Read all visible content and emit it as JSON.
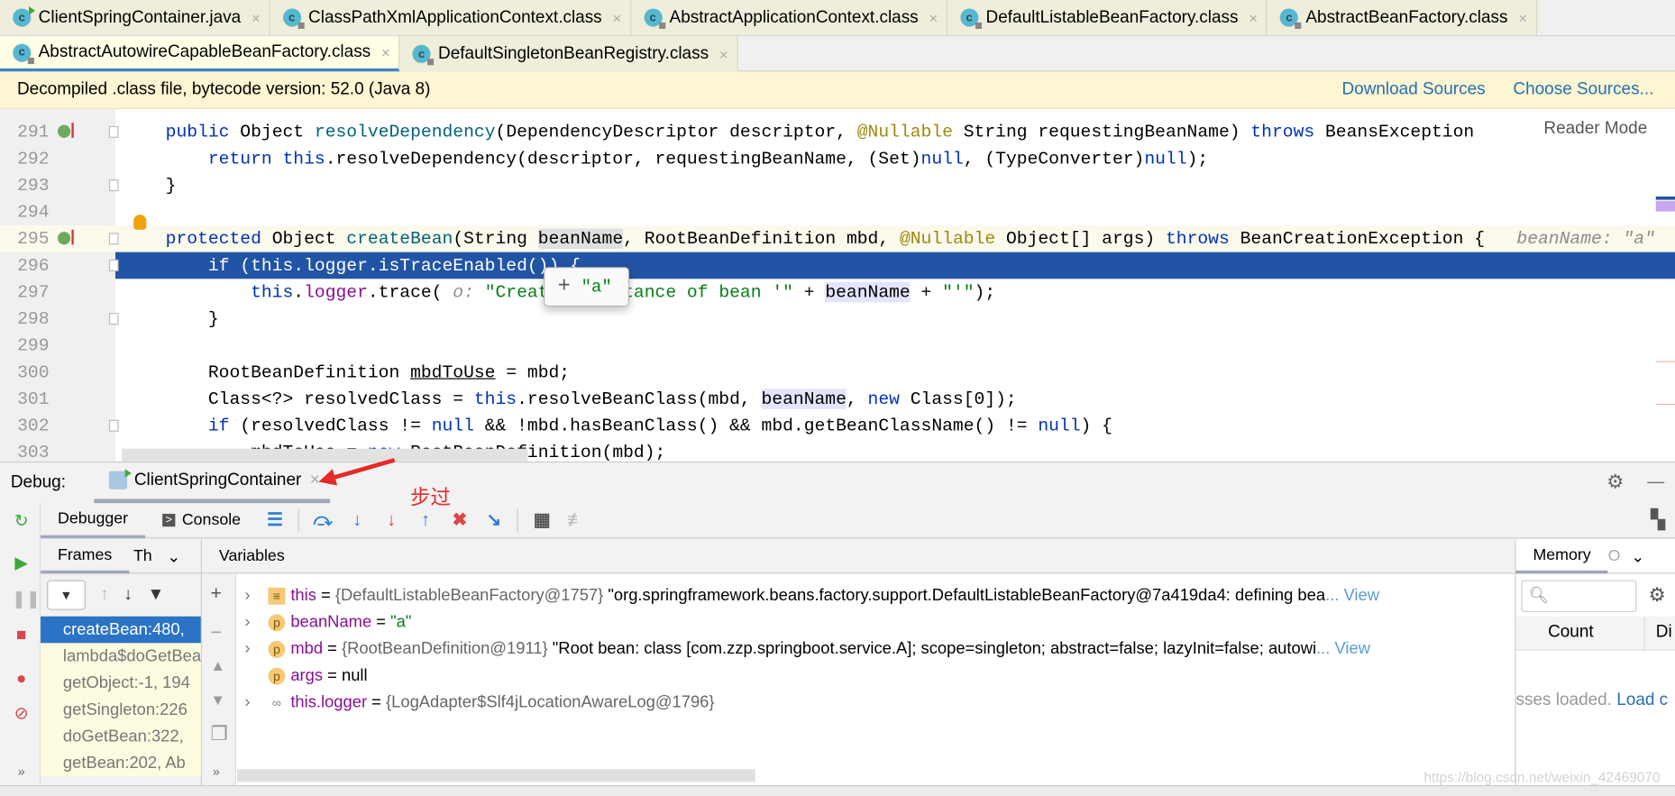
{
  "tabs_row1": [
    {
      "label": "ClientSpringContainer.java",
      "icon": "java-class-run-icon"
    },
    {
      "label": "ClassPathXmlApplicationContext.class",
      "icon": "class-file-icon"
    },
    {
      "label": "AbstractApplicationContext.class",
      "icon": "class-file-icon"
    },
    {
      "label": "DefaultListableBeanFactory.class",
      "icon": "class-file-icon"
    },
    {
      "label": "AbstractBeanFactory.class",
      "icon": "class-file-icon"
    }
  ],
  "tabs_row2": [
    {
      "label": "AbstractAutowireCapableBeanFactory.class",
      "icon": "class-file-icon",
      "active": true
    },
    {
      "label": "DefaultSingletonBeanRegistry.class",
      "icon": "class-file-icon"
    }
  ],
  "tab_close": "×",
  "class_icon_letter": "c",
  "notice": {
    "text": "Decompiled .class file, bytecode version: 52.0 (Java 8)",
    "download": "Download Sources",
    "choose": "Choose Sources..."
  },
  "editor": {
    "reader_mode": "Reader Mode",
    "tooltip": {
      "plus": "+",
      "value": "\"a\""
    },
    "lines": [
      {
        "n": "291",
        "impl": true,
        "tokens": [
          [
            "public ",
            "kw"
          ],
          [
            "Object ",
            ""
          ],
          [
            "resolveDependency",
            "fn"
          ],
          [
            "(DependencyDescriptor descriptor, ",
            ""
          ],
          [
            "@Nullable ",
            "ann"
          ],
          [
            "String requestingBeanName) ",
            ""
          ],
          [
            "throws ",
            "kw"
          ],
          [
            "BeansException ",
            ""
          ]
        ]
      },
      {
        "n": "292",
        "tokens": [
          [
            "    return ",
            "kw"
          ],
          [
            "this",
            "kw"
          ],
          [
            ".resolveDependency(descriptor, requestingBeanName, (Set)",
            ""
          ],
          [
            "null",
            "kw"
          ],
          [
            ", (TypeConverter)",
            ""
          ],
          [
            "null",
            "kw"
          ],
          [
            ");",
            ""
          ]
        ]
      },
      {
        "n": "293",
        "tokens": [
          [
            "}",
            ""
          ]
        ]
      },
      {
        "n": "294",
        "tokens": []
      },
      {
        "n": "295",
        "impl": true,
        "caret": true,
        "tokens": [
          [
            "protected ",
            "kw"
          ],
          [
            "Object ",
            ""
          ],
          [
            "createBean",
            "fn"
          ],
          [
            "(String ",
            ""
          ],
          [
            "beanName",
            "hov"
          ],
          [
            ", RootBeanDefinition mbd, ",
            ""
          ],
          [
            "@Nullable ",
            "ann"
          ],
          [
            "Object[] args) ",
            ""
          ],
          [
            "throws ",
            "kw"
          ],
          [
            "BeanCreationException {   ",
            ""
          ],
          [
            "beanName: \"a\"",
            "inl"
          ]
        ]
      },
      {
        "n": "296",
        "exec": true,
        "tokens": [
          [
            "    if (this.logger.isTraceEnabled()) {",
            ""
          ]
        ]
      },
      {
        "n": "297",
        "tokens": [
          [
            "        this",
            "kw"
          ],
          [
            ".",
            ""
          ],
          [
            "logger",
            "fld"
          ],
          [
            ".trace( ",
            ""
          ],
          [
            "o: ",
            "inl"
          ],
          [
            "\"Creating instance of bean '\"",
            "str"
          ],
          [
            " + ",
            ""
          ],
          [
            "beanName",
            "sel"
          ],
          [
            " + ",
            ""
          ],
          [
            "\"'\"",
            "str"
          ],
          [
            ");",
            ""
          ]
        ]
      },
      {
        "n": "298",
        "tokens": [
          [
            "    }",
            ""
          ]
        ]
      },
      {
        "n": "299",
        "tokens": []
      },
      {
        "n": "300",
        "tokens": [
          [
            "    RootBeanDefinition ",
            ""
          ],
          [
            "mbdToUse",
            "u"
          ],
          [
            " = mbd;",
            ""
          ]
        ]
      },
      {
        "n": "301",
        "tokens": [
          [
            "    Class<?> resolvedClass = ",
            ""
          ],
          [
            "this",
            "kw"
          ],
          [
            ".resolveBeanClass(mbd, ",
            ""
          ],
          [
            "beanName",
            "sel"
          ],
          [
            ", ",
            ""
          ],
          [
            "new ",
            "kw"
          ],
          [
            "Class[0]);",
            ""
          ]
        ]
      },
      {
        "n": "302",
        "tokens": [
          [
            "    if ",
            "kw"
          ],
          [
            "(resolvedClass != ",
            ""
          ],
          [
            "null ",
            "kw"
          ],
          [
            "&& !mbd.hasBeanClass() && mbd.getBeanClassName() != ",
            ""
          ],
          [
            "null",
            "kw"
          ],
          [
            ") {",
            ""
          ]
        ]
      },
      {
        "n": "303",
        "tokens": [
          [
            "        ",
            ""
          ],
          [
            "mbdToUse",
            "u"
          ],
          [
            " = ",
            ""
          ],
          [
            "new ",
            "kw"
          ],
          [
            "RootBeanDefinition(mbd);",
            ""
          ]
        ]
      }
    ]
  },
  "debug": {
    "label": "Debug:",
    "session": "ClientSpringContainer",
    "annotation": "步过",
    "tabs": {
      "debugger": "Debugger",
      "console": "Console"
    },
    "frames_tab": "Frames",
    "threads_tab": "Th",
    "frames": [
      "createBean:480, ",
      "lambda$doGetBean",
      "getObject:-1, 194",
      "getSingleton:226",
      "doGetBean:322, ",
      "getBean:202, Ab"
    ],
    "variables_title": "Variables",
    "variables": [
      {
        "name": "this",
        "type": "{DefaultListableBeanFactory@1757}",
        "value": " \"org.springframework.beans.factory.support.DefaultListableBeanFactory@7a419da4: defining bea",
        "view": "... View",
        "icon": "field-list-icon",
        "expandable": true
      },
      {
        "name": "beanName",
        "eq": " = ",
        "str": "\"a\"",
        "icon": "parameter-icon",
        "expandable": true
      },
      {
        "name": "mbd",
        "type": "{RootBeanDefinition@1911}",
        "value": " \"Root bean: class [com.zzp.springboot.service.A]; scope=singleton; abstract=false; lazyInit=false; autowi",
        "view": "... View",
        "icon": "parameter-icon",
        "expandable": true
      },
      {
        "name": "args",
        "eq": " = ",
        "plain": "null",
        "icon": "parameter-icon",
        "expandable": false
      },
      {
        "name": "this.logger",
        "type": "{LogAdapter$Slf4jLocationAwareLog@1796}",
        "icon": "watch-icon",
        "expandable": true
      }
    ],
    "memory": {
      "tab": "Memory",
      "other": "O",
      "count": "Count",
      "diff": "Di",
      "loaded": "sses loaded. ",
      "load_link": "Load c"
    }
  },
  "watermark": "https://blog.csdn.net/weixin_42469070"
}
